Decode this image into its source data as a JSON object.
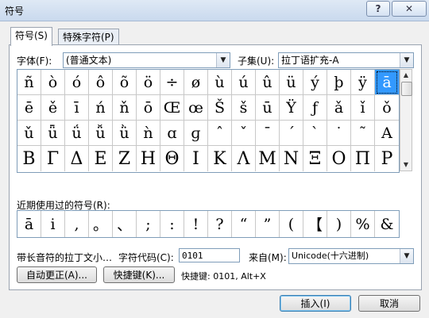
{
  "window": {
    "title": "符号",
    "help_button": "?",
    "close_button": "✕"
  },
  "tabs": [
    {
      "label": "符号(S)"
    },
    {
      "label": "特殊字符(P)"
    }
  ],
  "font": {
    "label": "字体(F):",
    "value": "(普通文本)"
  },
  "subset": {
    "label": "子集(U):",
    "value": "拉丁语扩充-A"
  },
  "symbol_rows": [
    [
      "ñ",
      "ò",
      "ó",
      "ô",
      "õ",
      "ö",
      "÷",
      "ø",
      "ù",
      "ú",
      "û",
      "ü",
      "ý",
      "þ",
      "ÿ",
      "ā"
    ],
    [
      "ē",
      "ě",
      "ī",
      "ń",
      "ň",
      "ō",
      "Œ",
      "œ",
      "Š",
      "š",
      "ū",
      "Ÿ",
      "ƒ",
      "ǎ",
      "ǐ",
      "ǒ"
    ],
    [
      "ǔ",
      "ǖ",
      "ǘ",
      "ǚ",
      "ǜ",
      "ǹ",
      "ɑ",
      "ɡ",
      "ˆ",
      "ˇ",
      "ˉ",
      "ˊ",
      "ˋ",
      "˙",
      "˜",
      "Α"
    ],
    [
      "Β",
      "Γ",
      "Δ",
      "Ε",
      "Ζ",
      "Η",
      "Θ",
      "Ι",
      "Κ",
      "Λ",
      "Μ",
      "Ν",
      "Ξ",
      "Ο",
      "Π",
      "Ρ"
    ]
  ],
  "selected_symbol": "ā",
  "recent": {
    "label": "近期使用过的符号(R):",
    "symbols": [
      "ā",
      "i",
      ",",
      "。",
      "、",
      ";",
      ":",
      "!",
      "?",
      "“",
      "”",
      "(",
      "【",
      ")",
      "%",
      "&"
    ]
  },
  "char_name": "带长音符的拉丁文小…",
  "char_code": {
    "label": "字符代码(C):",
    "value": "0101"
  },
  "from": {
    "label": "来自(M):",
    "value": "Unicode(十六进制)"
  },
  "buttons": {
    "autocorrect": "自动更正(A)...",
    "shortcut_key": "快捷键(K)...",
    "insert": "插入(I)",
    "cancel": "取消"
  },
  "shortcut_info": "快捷键: 0101, Alt+X",
  "icons": {
    "scroll_up": "scroll-up-arrow-icon",
    "scroll_down": "scroll-down-arrow-icon",
    "dropdown": "chevron-down-icon"
  }
}
